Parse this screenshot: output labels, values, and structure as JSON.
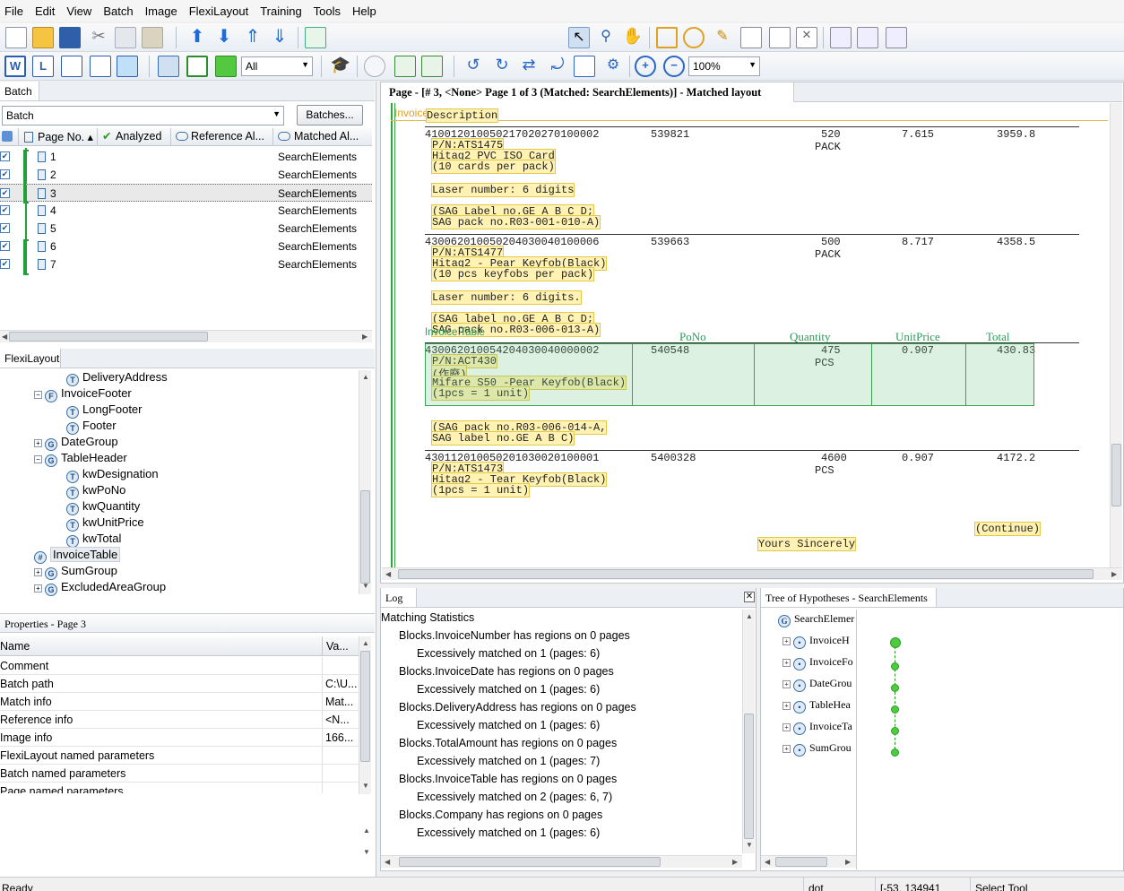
{
  "menu": [
    "File",
    "Edit",
    "View",
    "Batch",
    "Image",
    "FlexiLayout",
    "Training",
    "Tools",
    "Help"
  ],
  "toolbar": {
    "filter_value": "All",
    "zoom_value": "100%"
  },
  "batch_panel": {
    "tab": "Batch",
    "batch_select": "Batch",
    "batches_button": "Batches...",
    "columns": [
      "Page No.",
      "Analyzed",
      "Reference Al...",
      "Matched Al..."
    ],
    "rows": [
      {
        "no": "1",
        "matched": "SearchElements"
      },
      {
        "no": "2",
        "matched": "SearchElements"
      },
      {
        "no": "3",
        "matched": "SearchElements"
      },
      {
        "no": "4",
        "matched": "SearchElements"
      },
      {
        "no": "5",
        "matched": "SearchElements"
      },
      {
        "no": "6",
        "matched": "SearchElements"
      },
      {
        "no": "7",
        "matched": "SearchElements"
      }
    ]
  },
  "flexi_panel": {
    "tab": "FlexiLayout",
    "nodes": [
      {
        "label": "DeliveryAddress",
        "icon": "T",
        "indent": 3
      },
      {
        "label": "InvoiceFooter",
        "icon": "F",
        "indent": 2,
        "exp": "−"
      },
      {
        "label": "LongFooter",
        "icon": "T",
        "indent": 3
      },
      {
        "label": "Footer",
        "icon": "T",
        "indent": 3
      },
      {
        "label": "DateGroup",
        "icon": "G",
        "indent": 2,
        "exp": "+"
      },
      {
        "label": "TableHeader",
        "icon": "G",
        "indent": 2,
        "exp": "−"
      },
      {
        "label": "kwDesignation",
        "icon": "T",
        "indent": 3
      },
      {
        "label": "kwPoNo",
        "icon": "T",
        "indent": 3
      },
      {
        "label": "kwQuantity",
        "icon": "T",
        "indent": 3
      },
      {
        "label": "kwUnitPrice",
        "icon": "T",
        "indent": 3
      },
      {
        "label": "kwTotal",
        "icon": "T",
        "indent": 3
      },
      {
        "label": "InvoiceTable",
        "icon": "#",
        "indent": 2,
        "selected": true
      },
      {
        "label": "SumGroup",
        "icon": "G",
        "indent": 2,
        "exp": "+"
      },
      {
        "label": "ExcludedAreaGroup",
        "icon": "G",
        "indent": 2,
        "exp": "+"
      }
    ]
  },
  "properties": {
    "title": "Properties - Page 3",
    "col_name": "Name",
    "col_value": "Va...",
    "rows": [
      {
        "k": "Comment",
        "v": ""
      },
      {
        "k": "Batch path",
        "v": "C:\\U..."
      },
      {
        "k": "Match info",
        "v": "Mat..."
      },
      {
        "k": "Reference info",
        "v": "<N..."
      },
      {
        "k": "Image info",
        "v": "166..."
      },
      {
        "k": "FlexiLayout named parameters",
        "v": ""
      },
      {
        "k": "Batch named parameters",
        "v": ""
      },
      {
        "k": "Page named parameters",
        "v": ""
      }
    ]
  },
  "page_view": {
    "title": "Page - [# 3, <None> Page 1 of 3 (Matched: SearchElements)] - Matched layout",
    "labels": {
      "footer": "InvoiceTableFooter",
      "table": "Invoice Table"
    },
    "headers": [
      "Description",
      "PoNo",
      "Quantity",
      "UnitPrice",
      "Total"
    ],
    "items": [
      {
        "code": "410012010050217020270100002",
        "po": "539821",
        "qty": "520",
        "unit": "PACK",
        "price": "7.615",
        "total": "3959.8",
        "lines": [
          "P/N:ATS1475",
          "Hitag2 PVC ISO Card",
          "(10 cards per pack)",
          "",
          "Laser number: 6 digits",
          "",
          "(SAG Label no.GE A B C D;",
          "SAG pack no.R03-001-010-A)"
        ]
      },
      {
        "code": "430062010050204030040100006",
        "po": "539663",
        "qty": "500",
        "unit": "PACK",
        "price": "8.717",
        "total": "4358.5",
        "lines": [
          "P/N:ATS1477",
          "Hitag2 - Pear Keyfob(Black)",
          "(10 pcs keyfobs per pack)",
          "",
          "Laser number: 6 digits.",
          "",
          "(SAG label no.GE A B C D;",
          "SAG pack no.R03-006-013-A)"
        ]
      },
      {
        "code": "430062010054204030040000002",
        "po": "540548",
        "qty": "475",
        "unit": "PCS",
        "price": "0.907",
        "total": "430.83",
        "lines": [
          "P/N:ACT430",
          "(作廢)",
          "Mifare S50 -Pear Keyfob(Black)",
          "(1pcs = 1 unit)",
          "",
          "",
          "(SAG pack no.R03-006-014-A,",
          "SAG label no.GE A B C)"
        ]
      },
      {
        "code": "430112010050201030020100001",
        "po": "5400328",
        "qty": "4600",
        "unit": "PCS",
        "price": "0.907",
        "total": "4172.2",
        "lines": [
          "P/N:ATS1473",
          "Hitag2 - Tear Keyfob(Black)",
          "(1pcs = 1 unit)"
        ]
      }
    ],
    "continue": "(Continue)",
    "closing": "Yours  Sincerely"
  },
  "log": {
    "tab": "Log",
    "lines": [
      {
        "t": "Matching Statistics",
        "lvl": 0
      },
      {
        "t": "Blocks.InvoiceNumber has regions on 0 pages",
        "lvl": 1
      },
      {
        "t": "Excessively matched on 1 (pages: 6)",
        "lvl": 2
      },
      {
        "t": "Blocks.InvoiceDate has regions on 0 pages",
        "lvl": 1
      },
      {
        "t": "Excessively matched on 1 (pages: 6)",
        "lvl": 2
      },
      {
        "t": "Blocks.DeliveryAddress has regions on 0 pages",
        "lvl": 1
      },
      {
        "t": "Excessively matched on 1 (pages: 6)",
        "lvl": 2
      },
      {
        "t": "Blocks.TotalAmount has regions on 0 pages",
        "lvl": 1
      },
      {
        "t": "Excessively matched on 1 (pages: 7)",
        "lvl": 2
      },
      {
        "t": "Blocks.InvoiceTable has regions on 0 pages",
        "lvl": 1
      },
      {
        "t": "Excessively matched on 2 (pages: 6, 7)",
        "lvl": 2
      },
      {
        "t": "Blocks.Company has regions on 0 pages",
        "lvl": 1
      },
      {
        "t": "Excessively matched on 1 (pages: 6)",
        "lvl": 2
      }
    ]
  },
  "hypotheses": {
    "tab": "Tree of Hypotheses - SearchElements",
    "root": "SearchElemer",
    "nodes": [
      "InvoiceH",
      "InvoiceFo",
      "DateGrou",
      "TableHea",
      "InvoiceTa",
      "SumGrou"
    ]
  },
  "status": {
    "ready": "Ready",
    "dot": "dot",
    "coords": "[-53, 134941",
    "tool": "Select Tool"
  }
}
